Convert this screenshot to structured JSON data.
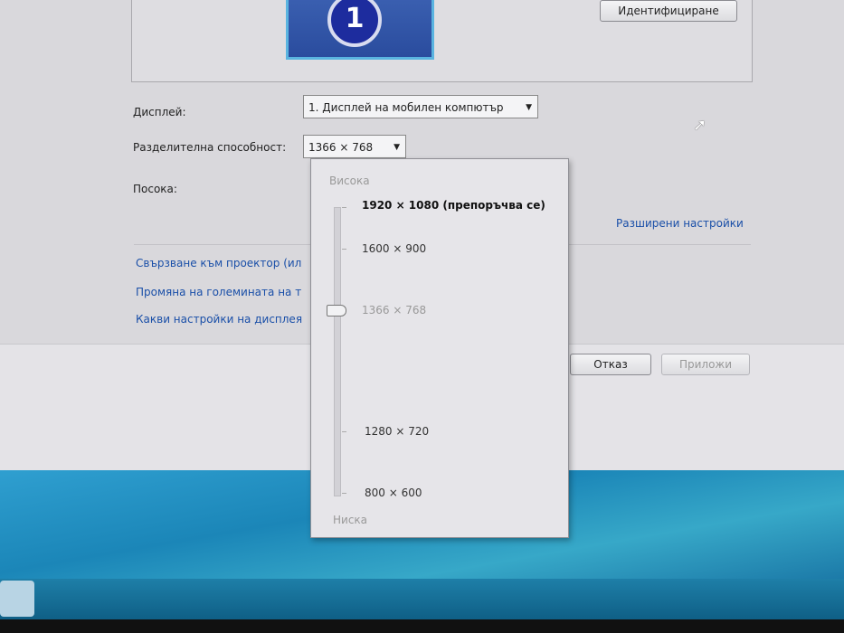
{
  "dialog": {
    "identify_button": "Идентифициране",
    "monitor_number": "1",
    "display_label": "Дисплей:",
    "display_value": "1. Дисплей на мобилен компютър",
    "resolution_label": "Разделителна способност:",
    "resolution_value": "1366 × 768",
    "orientation_label": "Посока:",
    "advanced_link": "Разширени настройки",
    "links": [
      "Свързване към проектор (ил",
      "Промяна на големината на т",
      "Какви настройки на дисплея"
    ],
    "cancel_button": "Отказ",
    "apply_button": "Приложи"
  },
  "resolution_popup": {
    "high_label": "Висока",
    "low_label": "Ниска",
    "options": [
      "1920 × 1080 (препоръчва се)",
      "1600 × 900",
      "1366 × 768",
      "1280 × 720",
      "800 × 600"
    ],
    "selected": "1366 × 768"
  }
}
